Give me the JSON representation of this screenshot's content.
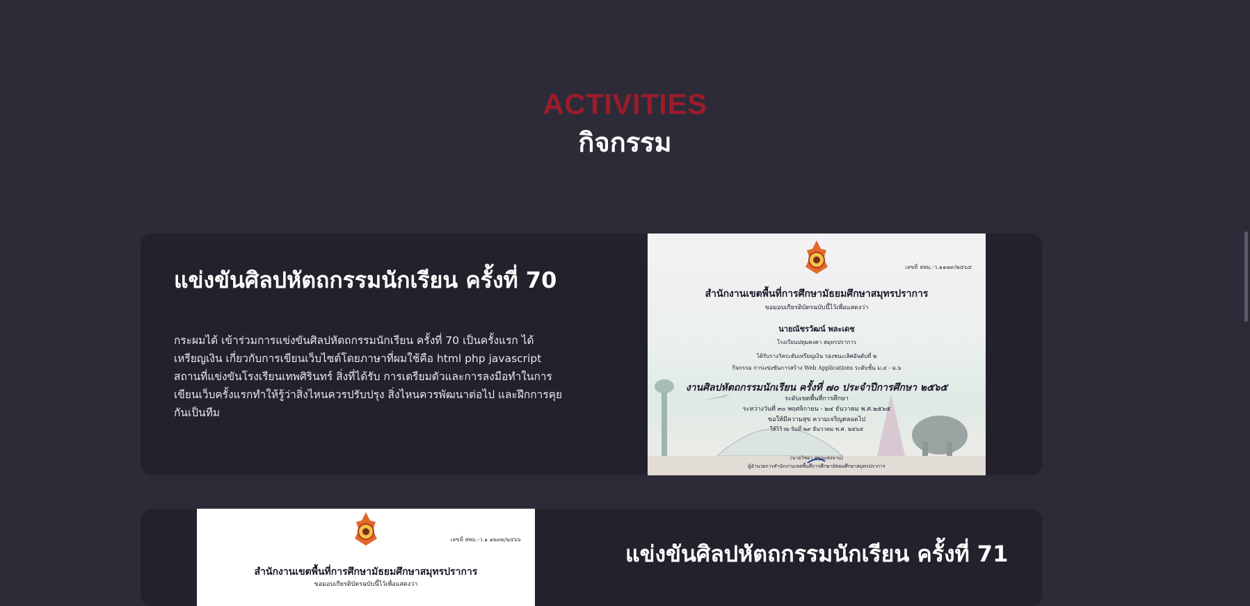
{
  "section": {
    "eyebrow": "ACTIVITIES",
    "title": "กิจกรรม"
  },
  "activities": [
    {
      "title": "แข่งขันศิลปหัตถกรรมนักเรียน ครั้งที่ 70",
      "description": "กระผมได้ เข้าร่วมการแข่งขันศิลปหัตถกรรมนักเรียน ครั้งที่ 70 เป็นครั้งแรก ได้เหรียญเงิน เกี่ยวกับการเขียนเว็บไซต์โดยภาษาที่ผมใช้คือ html php javascript สถานที่แข่งขันโรงเรียนเทพศิรินทร์ สิ่งที่ได้รับ การเตรียมตัวและการลงมือทำในการเขียนเว็บครั้งแรกทำให้รู้ว่าสิ่งไหนควรปรับปรุง สิ่งไหนควรพัฒนาต่อไป และฝึกการคุยกันเป็นทีม",
      "certificate": {
        "number": "เลขที่ สพม.-ว.๑๑๗๙/๒๕๖๕",
        "org": "สำนักงานเขตพื้นที่การศึกษามัธยมศึกษาสมุทรปราการ",
        "intro": "ขอมอบเกียรติบัตรฉบับนี้ไว้เพื่อแสดงว่า",
        "name": "นายณัชรวัฒน์ พละเดช",
        "school": "โรงเรียนปทุมคงคา สมุทรปราการ",
        "award": "ได้รับรางวัลระดับเหรียญเงิน รองชนะเลิศอันดับที่ ๒",
        "activity": "กิจกรรม การแข่งขันการสร้าง Web Applications ระดับชั้น ม.๔ - ม.๖",
        "event": "งานศิลปหัตถกรรมนักเรียน ครั้งที่ ๗๐ ประจำปีการศึกษา ๒๕๖๕",
        "level": "ระดับเขตพื้นที่การศึกษา",
        "dates": "ระหว่างวันที่ ๓๐ พฤศจิกายน - ๒๔ ธันวาคม พ.ศ.๒๕๖๕",
        "wish": "ขอให้มีความสุข ความเจริญตลอดไป",
        "given": "ให้ไว้ ณ วันที่ ๒๙ ธันวาคม พ.ศ. ๒๕๖๕",
        "signer": "(นายวิชยา สุขุมแสงจาน)",
        "signer_title": "ผู้อำนวยการสำนักงานเขตพื้นที่การศึกษามัธยมศึกษาสมุทรปราการ"
      }
    },
    {
      "title": "แข่งขันศิลปหัตถกรรมนักเรียน ครั้งที่ 71",
      "certificate": {
        "number": "เลขที่ สพม.-ว.๑ ๑๒๓๒/๒๕๖๖",
        "org": "สำนักงานเขตพื้นที่การศึกษามัธยมศึกษาสมุทรปราการ",
        "intro": "ขอมอบเกียรติบัตรฉบับนี้ไว้เพื่อแสดงว่า"
      }
    }
  ],
  "colors": {
    "background": "#2d2b38",
    "card": "#23212c",
    "accent": "#9b1c2b",
    "text": "#ffffff"
  }
}
